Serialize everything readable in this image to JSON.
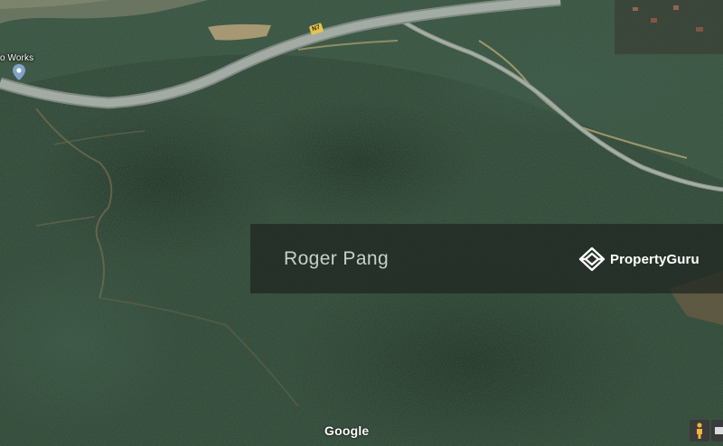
{
  "map": {
    "view": "satellite",
    "road_shield": "N7",
    "place_label": "o Works",
    "attribution": "Google",
    "controls": {
      "street_view": "pegman-icon",
      "layers": "layers-icon"
    }
  },
  "overlay": {
    "agent_name": "Roger Pang",
    "brand_name": "PropertyGuru",
    "brand_icon": "propertyguru-logo-icon"
  },
  "colors": {
    "forest": "#2e4634",
    "road": "#9aa69d",
    "overlay": "#1e2620"
  }
}
